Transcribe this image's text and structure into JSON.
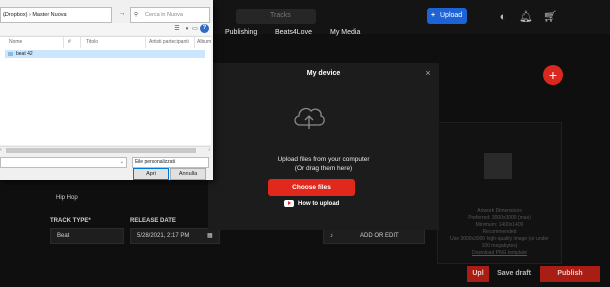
{
  "app": {
    "search_label": "Tracks",
    "upload_label": "Upload",
    "nav": [
      "Publishing",
      "Beats4Love",
      "My Media"
    ],
    "add_icon": "plus-icon",
    "genre_value": "Hip Hop",
    "track_type_label": "TRACK TYPE*",
    "track_type_value": "Beat",
    "release_date_label": "RELEASE DATE",
    "release_date_value": "5/28/2021, 2:17 PM",
    "right_panel_lines": [
      "Artwork Dimensions",
      "Preferred: 3000x3000 (max)",
      "Minimum: 1400x1400",
      "Recommended",
      "Use 3000x3000 high-quality image (or under",
      "100 megabytes)",
      "Download PNG template"
    ],
    "right_panel_btn": "ADD OR EDIT",
    "bottom_upload": "Upl",
    "save_draft": "Save draft",
    "publish": "Publish"
  },
  "modal": {
    "title": "My device",
    "line1": "Upload files from your computer",
    "line2": "(Or drag them here)",
    "choose_label": "Choose files",
    "howto_label": "How to upload"
  },
  "dialog": {
    "address": "(Dropbox) › Master Nuova",
    "search_placeholder": "Cerca in Nuova",
    "columns": [
      "Nome",
      "#",
      "Titolo",
      "Artisti partecipanti",
      "Album"
    ],
    "rows": [
      {
        "name": "beat 42"
      }
    ],
    "file_type": "File personalizzati",
    "open_label": "Apri",
    "cancel_label": "Annulla"
  },
  "colors": {
    "accent_red": "#e1281d",
    "accent_blue": "#1d63d6",
    "background": "#0f0f0f"
  }
}
